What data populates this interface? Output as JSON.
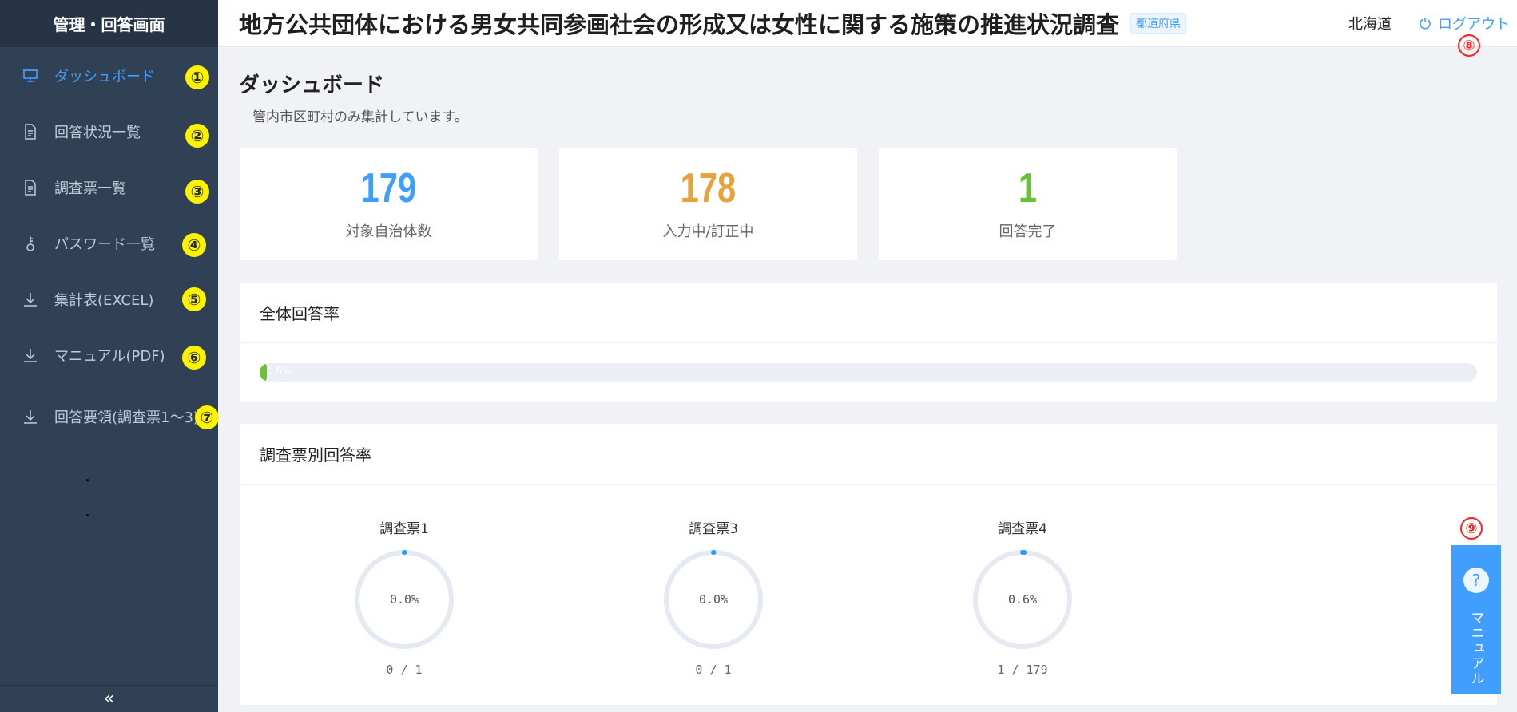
{
  "sidebar": {
    "title": "管理・回答画面",
    "items": [
      {
        "label": "ダッシュボード",
        "badge": "①",
        "icon": "presentation-icon"
      },
      {
        "label": "回答状況一覧",
        "badge": "②",
        "icon": "document-icon"
      },
      {
        "label": "調査票一覧",
        "badge": "③",
        "icon": "document-icon"
      },
      {
        "label": "パスワード一覧",
        "badge": "④",
        "icon": "key-icon"
      },
      {
        "label": "集計表(EXCEL)",
        "badge": "⑤",
        "icon": "download-icon"
      },
      {
        "label": "マニュアル(PDF)",
        "badge": "⑥",
        "icon": "download-icon"
      },
      {
        "label": "回答要領(調査票1～3)",
        "badge": "⑦",
        "icon": "download-icon"
      }
    ],
    "collapse_icon": "«"
  },
  "header": {
    "title": "地方公共団体における男女共同参画社会の形成又は女性に関する施策の推進状況調査",
    "tag": "都道府県",
    "prefecture": "北海道",
    "logout": "ログアウト",
    "logout_badge": "⑧"
  },
  "main": {
    "title": "ダッシュボード",
    "subtitle": "管内市区町村のみ集計しています。",
    "stats": [
      {
        "value": "179",
        "label": "対象自治体数",
        "color": "#409eff"
      },
      {
        "value": "178",
        "label": "入力中/訂正中",
        "color": "#e6a23c"
      },
      {
        "value": "1",
        "label": "回答完了",
        "color": "#67c23a"
      }
    ],
    "overall": {
      "title": "全体回答率",
      "percent_text": "0.6%",
      "percent": 0.6
    },
    "by_survey": {
      "title": "調査票別回答率",
      "gauges": [
        {
          "label": "調査票1",
          "percent_text": "0.0%",
          "percent": 0.0,
          "count": "0 / 1"
        },
        {
          "label": "調査票3",
          "percent_text": "0.0%",
          "percent": 0.0,
          "count": "0 / 1"
        },
        {
          "label": "調査票4",
          "percent_text": "0.6%",
          "percent": 0.6,
          "count": "1 / 179"
        }
      ]
    }
  },
  "manual_button": {
    "label": "マニュアル",
    "badge": "⑨",
    "icon": "question-icon"
  }
}
